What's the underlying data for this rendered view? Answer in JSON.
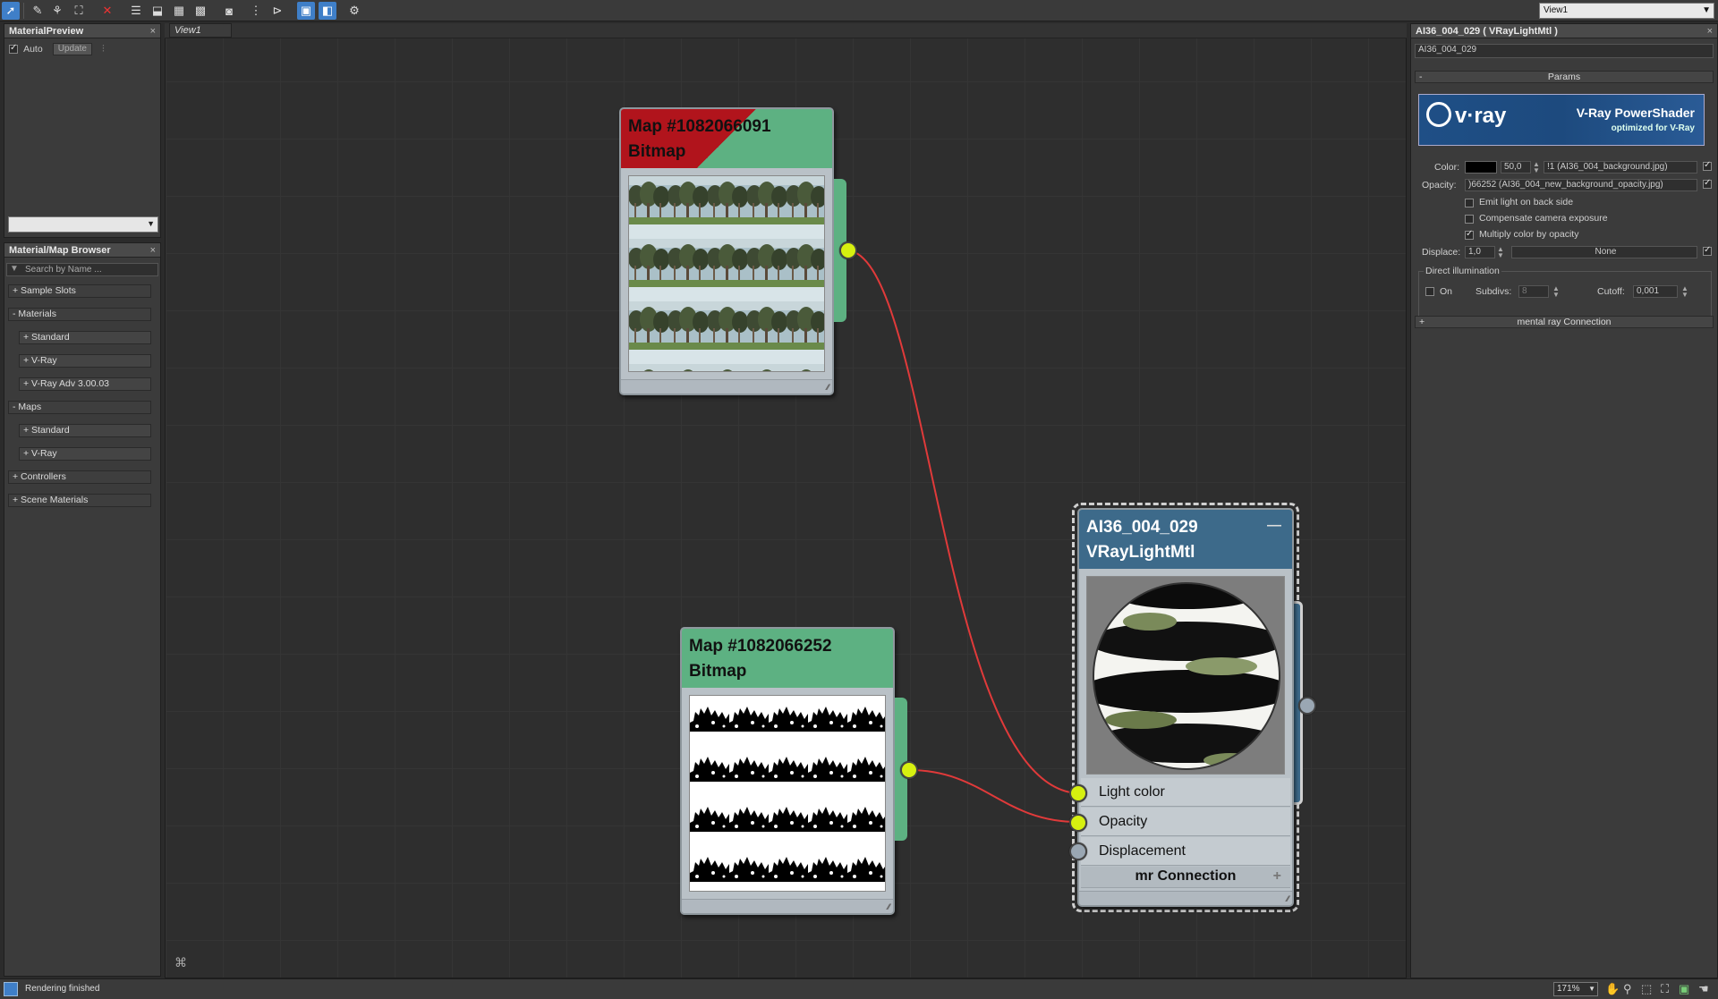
{
  "toolbar": {
    "icons": [
      "select-arrow-icon",
      "eyedropper-icon",
      "pick-material-icon",
      "put-to-scene-icon",
      "delete-icon",
      "layout-icon",
      "move-children-icon",
      "background-icon",
      "checker-icon",
      "sample-type-icon",
      "lay-out-all-icon",
      "lay-out-children-icon",
      "show-map-icon",
      "show-end-result-icon",
      "navigator-icon"
    ],
    "view_selector": "View1"
  },
  "material_preview": {
    "title": "MaterialPreview",
    "auto_label": "Auto",
    "auto_checked": true,
    "update_label": "Update"
  },
  "browser": {
    "title": "Material/Map Browser",
    "search_placeholder": "Search by Name ...",
    "tree": [
      {
        "label": "+ Sample Slots",
        "level": 0
      },
      {
        "label": "- Materials",
        "level": 0
      },
      {
        "label": "+ Standard",
        "level": 1
      },
      {
        "label": "+ V-Ray",
        "level": 1
      },
      {
        "label": "+ V-Ray Adv 3.00.03",
        "level": 1
      },
      {
        "label": "- Maps",
        "level": 0
      },
      {
        "label": "+ Standard",
        "level": 1
      },
      {
        "label": "+ V-Ray",
        "level": 1
      },
      {
        "label": "+ Controllers",
        "level": 0
      },
      {
        "label": "+ Scene Materials",
        "level": 0
      }
    ]
  },
  "view": {
    "tab_label": "View1"
  },
  "nodes": {
    "map1": {
      "title": "Map #1082066091",
      "type": "Bitmap"
    },
    "map2": {
      "title": "Map #1082066252",
      "type": "Bitmap"
    },
    "material": {
      "title": "AI36_004_029",
      "type": "VRayLightMtl",
      "slots": [
        "Light color",
        "Opacity",
        "Displacement"
      ],
      "mr_connection": "mr Connection"
    }
  },
  "right_panel": {
    "title": "AI36_004_029  ( VRayLightMtl )",
    "name_field": "AI36_004_029",
    "params_rollout": "Params",
    "banner_brand": "v·ray",
    "banner_title": "V-Ray PowerShader",
    "banner_subtitle": "optimized for V-Ray",
    "color_label": "Color:",
    "color_value": "50,0",
    "color_map": "!1 (AI36_004_background.jpg)",
    "opacity_label": "Opacity:",
    "opacity_map": ")66252 (AI36_004_new_background_opacity.jpg)",
    "emit_back": "Emit light on back side",
    "compensate": "Compensate camera exposure",
    "multiply": "Multiply color by opacity",
    "displace_label": "Displace:",
    "displace_value": "1,0",
    "displace_map": "None",
    "direct_group": "Direct illumination",
    "on_label": "On",
    "subdivs_label": "Subdivs:",
    "subdivs_value": "8",
    "cutoff_label": "Cutoff:",
    "cutoff_value": "0,001",
    "mr_rollout": "mental ray Connection"
  },
  "status": {
    "message": "Rendering finished",
    "zoom": "171%"
  },
  "colors": {
    "accent": "#3f7fc8",
    "node_green": "#5db182",
    "node_blue": "#3d6a8a",
    "wire_red": "#e03a3a",
    "socket_yellow": "#d6f010"
  }
}
